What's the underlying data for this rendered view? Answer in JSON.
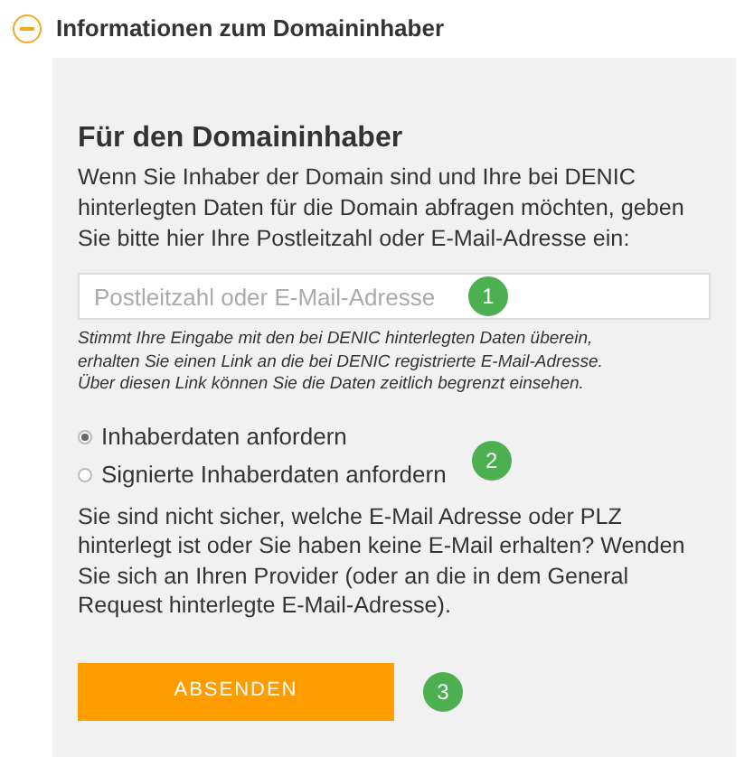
{
  "section": {
    "title": "Informationen zum Domaininhaber",
    "expanded": true
  },
  "panel": {
    "heading": "Für den Domaininhaber",
    "intro": "Wenn Sie Inhaber der Domain sind und Ihre bei DENIC hinterlegten Daten für die Domain abfragen möchten, geben Sie bitte hier Ihre Postleitzahl oder E-Mail-Adresse ein:",
    "field": {
      "placeholder": "Postleitzahl oder E-Mail-Adresse",
      "badge": "1"
    },
    "hint": "Stimmt Ihre Eingabe mit den bei DENIC hinterlegten Daten überein, erhalten Sie einen Link an die bei DENIC registrierte E-Mail-Adresse. Über diesen Link können Sie die Daten zeitlich begrenzt einsehen.",
    "options": [
      {
        "label": "Inhaberdaten anfordern",
        "selected": true
      },
      {
        "label": "Signierte Inhaberdaten anfordern",
        "selected": false
      }
    ],
    "options_badge": "2",
    "help": "Sie sind nicht sicher, welche E-Mail Adresse oder PLZ hinterlegt ist oder Sie haben keine E-Mail erhalten? Wenden Sie sich an Ihren Provider (oder an die in dem General Request hinterlegte E-Mail-Adresse).",
    "submit": {
      "label": "ABSENDEN",
      "badge": "3"
    }
  }
}
